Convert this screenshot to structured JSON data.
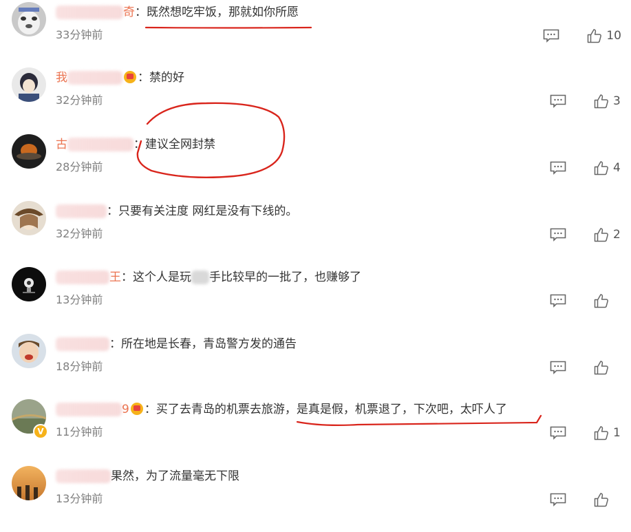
{
  "colors": {
    "username": "#eb7350",
    "annotation": "#d9251c",
    "meta": "#808080"
  },
  "comments": [
    {
      "username": "奇",
      "text": "：既然想吃牢饭，那就如你所愿",
      "time": "33分钟前",
      "likes": "10",
      "crown": false
    },
    {
      "username": "我",
      "text": "：禁的好",
      "time": "32分钟前",
      "likes": "3",
      "crown": true
    },
    {
      "username": "古",
      "text": "：建议全网封禁",
      "time": "28分钟前",
      "likes": "4",
      "crown": false
    },
    {
      "username": "",
      "text": "：只要有关注度 网红是没有下线的。",
      "time": "32分钟前",
      "likes": "2",
      "crown": false
    },
    {
      "username": "王",
      "text": "：这个人是玩",
      "text2": "手比较早的一批了，也赚够了",
      "time": "13分钟前",
      "likes": "",
      "crown": false
    },
    {
      "username": "",
      "text": "：所在地是长春，青岛警方发的通告",
      "time": "18分钟前",
      "likes": "",
      "crown": false
    },
    {
      "username": "9",
      "text": "：买了去青岛的机票去旅游，是真是假，机票退了，下次吧，太吓人了",
      "time": "11分钟前",
      "likes": "1",
      "crown": true,
      "verified": "V"
    },
    {
      "username": "",
      "text": "果然，为了流量毫无下限",
      "time": "13分钟前",
      "likes": "",
      "crown": false
    }
  ],
  "icons": {
    "reply": "comment-icon",
    "like": "thumbs-up-icon"
  }
}
